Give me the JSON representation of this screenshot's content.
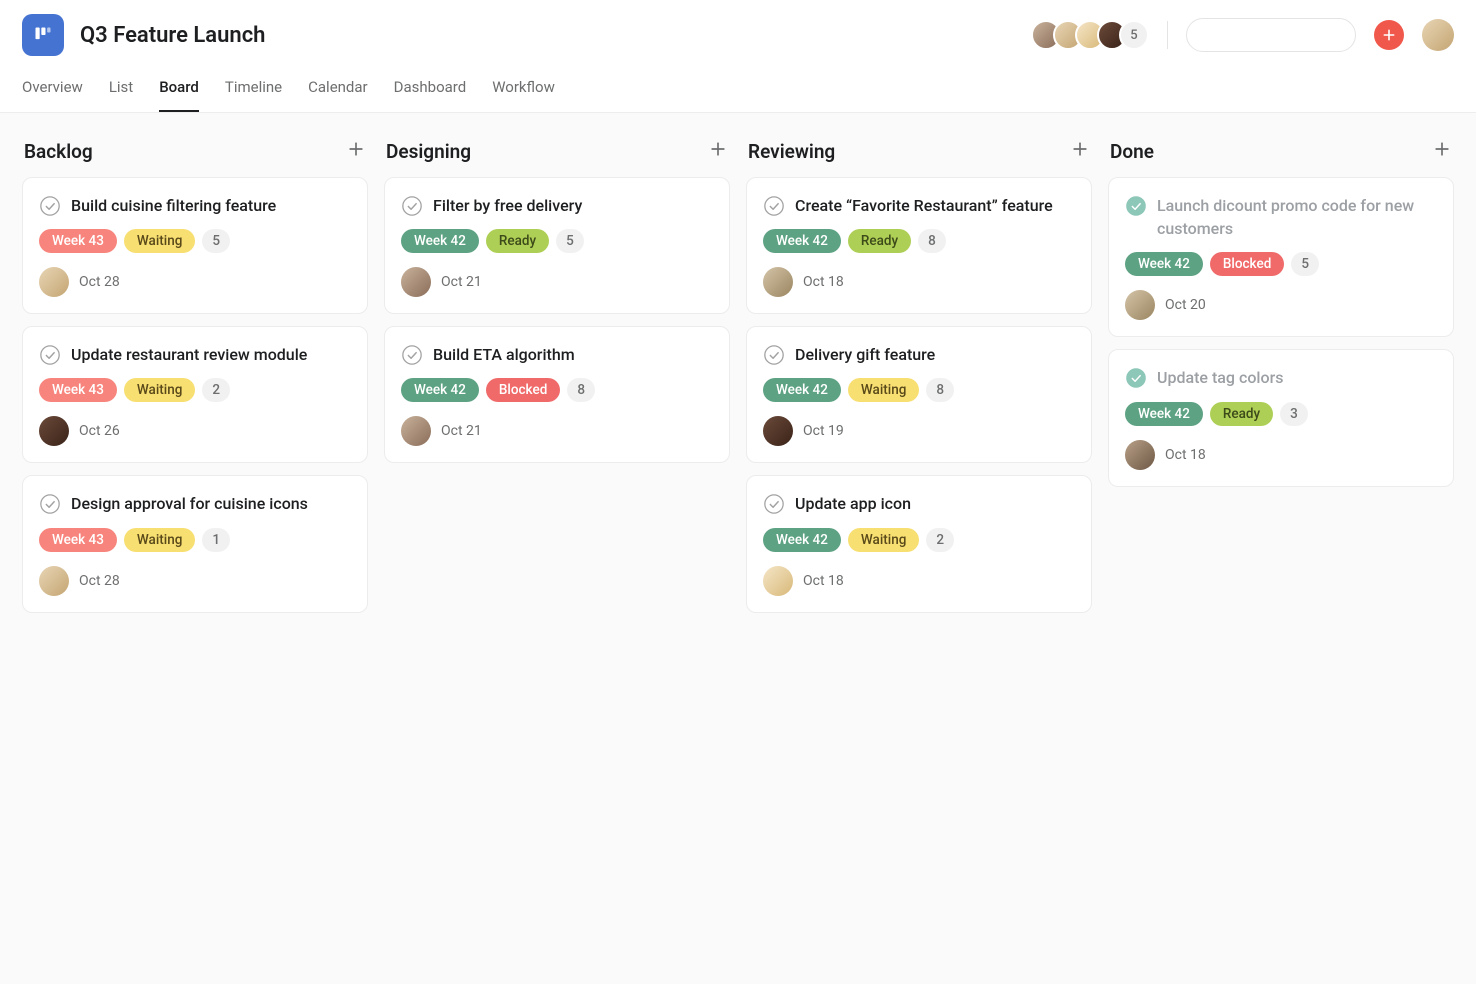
{
  "project": {
    "title": "Q3 Feature Launch"
  },
  "header": {
    "member_overflow": "5",
    "search_placeholder": ""
  },
  "tabs": [
    {
      "label": "Overview",
      "active": false
    },
    {
      "label": "List",
      "active": false
    },
    {
      "label": "Board",
      "active": true
    },
    {
      "label": "Timeline",
      "active": false
    },
    {
      "label": "Calendar",
      "active": false
    },
    {
      "label": "Dashboard",
      "active": false
    },
    {
      "label": "Workflow",
      "active": false
    }
  ],
  "columns": [
    {
      "title": "Backlog",
      "cards": [
        {
          "title": "Build cuisine filtering feature",
          "done": false,
          "tags": [
            {
              "text": "Week 43",
              "cls": "tag-red"
            },
            {
              "text": "Waiting",
              "cls": "tag-yellow"
            }
          ],
          "points": "5",
          "avatar_cls": "av-1",
          "date": "Oct 28"
        },
        {
          "title": "Update restaurant review module",
          "done": false,
          "tags": [
            {
              "text": "Week 43",
              "cls": "tag-red"
            },
            {
              "text": "Waiting",
              "cls": "tag-yellow"
            }
          ],
          "points": "2",
          "avatar_cls": "av-3",
          "date": "Oct 26"
        },
        {
          "title": "Design approval for cuisine icons",
          "done": false,
          "tags": [
            {
              "text": "Week 43",
              "cls": "tag-red"
            },
            {
              "text": "Waiting",
              "cls": "tag-yellow"
            }
          ],
          "points": "1",
          "avatar_cls": "av-1",
          "date": "Oct 28"
        }
      ]
    },
    {
      "title": "Designing",
      "cards": [
        {
          "title": "Filter by free delivery",
          "done": false,
          "tags": [
            {
              "text": "Week 42",
              "cls": "tag-teal"
            },
            {
              "text": "Ready",
              "cls": "tag-green"
            }
          ],
          "points": "5",
          "avatar_cls": "av-0",
          "date": "Oct 21"
        },
        {
          "title": "Build ETA algorithm",
          "done": false,
          "tags": [
            {
              "text": "Week 42",
              "cls": "tag-teal"
            },
            {
              "text": "Blocked",
              "cls": "tag-block"
            }
          ],
          "points": "8",
          "avatar_cls": "av-0",
          "date": "Oct 21"
        }
      ]
    },
    {
      "title": "Reviewing",
      "cards": [
        {
          "title": "Create “Favorite Restaurant” feature",
          "done": false,
          "tags": [
            {
              "text": "Week 42",
              "cls": "tag-teal"
            },
            {
              "text": "Ready",
              "cls": "tag-green"
            }
          ],
          "points": "8",
          "avatar_cls": "av-4",
          "date": "Oct 18"
        },
        {
          "title": "Delivery gift feature",
          "done": false,
          "tags": [
            {
              "text": "Week 42",
              "cls": "tag-teal"
            },
            {
              "text": "Waiting",
              "cls": "tag-yellow"
            }
          ],
          "points": "8",
          "avatar_cls": "av-3",
          "date": "Oct 19"
        },
        {
          "title": "Update app icon",
          "done": false,
          "tags": [
            {
              "text": "Week 42",
              "cls": "tag-teal"
            },
            {
              "text": "Waiting",
              "cls": "tag-yellow"
            }
          ],
          "points": "2",
          "avatar_cls": "av-2",
          "date": "Oct 18"
        }
      ]
    },
    {
      "title": "Done",
      "cards": [
        {
          "title": "Launch dicount promo code for new customers",
          "done": true,
          "tags": [
            {
              "text": "Week 42",
              "cls": "tag-teal"
            },
            {
              "text": "Blocked",
              "cls": "tag-block"
            }
          ],
          "points": "5",
          "avatar_cls": "av-4",
          "date": "Oct 20"
        },
        {
          "title": "Update tag colors",
          "done": true,
          "tags": [
            {
              "text": "Week 42",
              "cls": "tag-teal"
            },
            {
              "text": "Ready",
              "cls": "tag-green"
            }
          ],
          "points": "3",
          "avatar_cls": "av-5",
          "date": "Oct 18"
        }
      ]
    }
  ]
}
